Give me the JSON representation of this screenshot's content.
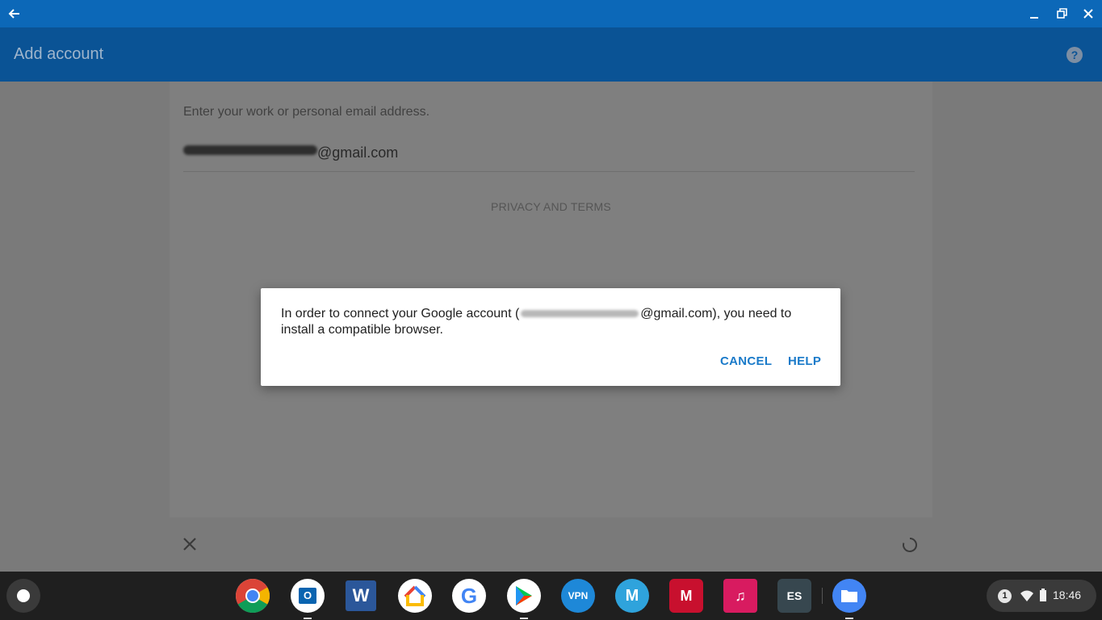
{
  "window": {
    "back_icon": "arrow-left-icon",
    "controls": [
      "minimize-icon",
      "restore-icon",
      "close-icon"
    ]
  },
  "appbar": {
    "title": "Add account",
    "help_icon": "help-circle-icon"
  },
  "form": {
    "prompt": "Enter your work or personal email address.",
    "email_domain": "@gmail.com",
    "privacy_link": "PRIVACY AND TERMS"
  },
  "footer": {
    "close_icon": "close-icon",
    "spinner_icon": "loading-spinner-icon"
  },
  "dialog": {
    "message_before": "In order to connect your Google account (",
    "message_after": "@gmail.com), you need to install a compatible browser.",
    "cancel_label": "CANCEL",
    "help_label": "HELP",
    "accent_color": "#1a7ac9"
  },
  "shelf": {
    "apps": [
      {
        "name": "chrome",
        "running": false
      },
      {
        "name": "outlook",
        "running": true
      },
      {
        "name": "word",
        "running": false
      },
      {
        "name": "google-home",
        "running": false
      },
      {
        "name": "google",
        "running": false
      },
      {
        "name": "play-store",
        "running": true
      },
      {
        "name": "vpn-pro",
        "running": false
      },
      {
        "name": "maxthon",
        "running": false
      },
      {
        "name": "mcafee",
        "running": false
      },
      {
        "name": "music-fire",
        "running": false
      },
      {
        "name": "es-file-explorer",
        "running": false
      },
      {
        "name": "files",
        "running": true
      }
    ],
    "notification_count": "1",
    "clock": "18:46"
  }
}
